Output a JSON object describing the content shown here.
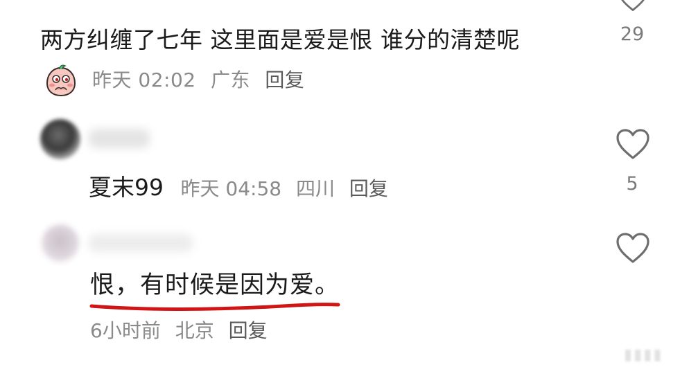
{
  "comment1": {
    "text": "两方纠缠了七年 这里面是爱是恨 谁分的清楚呢",
    "emoji": "blush-face-sticker",
    "time": "昨天 02:02",
    "location": "广东",
    "reply_label": "回复",
    "likes": "29"
  },
  "comment2": {
    "author_blurred": "Tand",
    "reply_text": "夏末99",
    "time": "昨天 04:58",
    "location": "四川",
    "reply_label": "回复",
    "likes": "5"
  },
  "comment3": {
    "author_blurred": "",
    "text": "恨，有时候是因为爱。",
    "time": "6小时前",
    "location": "北京",
    "reply_label": "回复"
  },
  "colors": {
    "meta_gray": "#8a8a8a",
    "underline_red": "#d01515",
    "heart_stroke": "#6e6e6e"
  },
  "icons": [
    "heart-outline-icon",
    "blush-face-sticker"
  ]
}
